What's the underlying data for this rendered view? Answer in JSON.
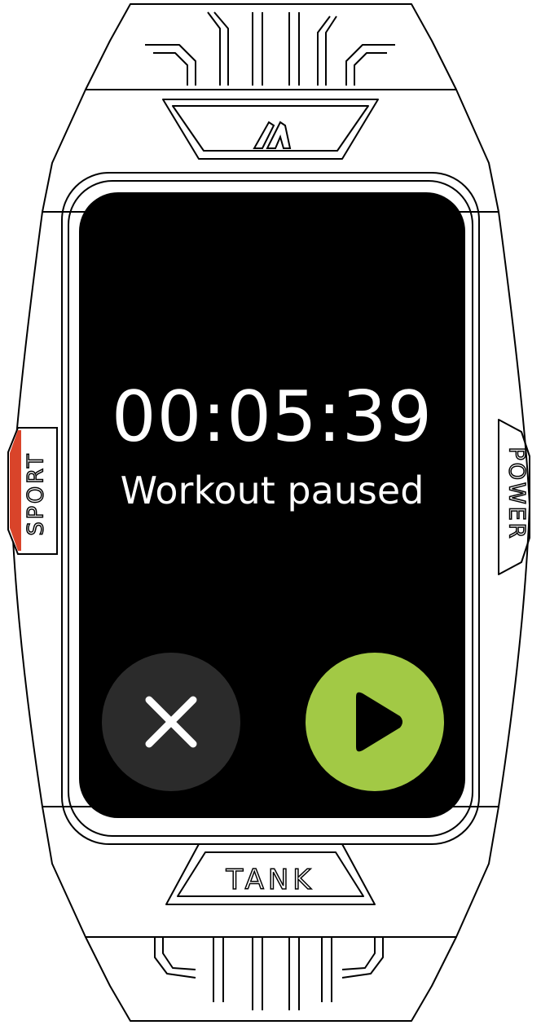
{
  "device": {
    "side_buttons": {
      "left_label": "SPORT",
      "right_label": "POWER"
    },
    "bottom_label": "TANK",
    "accent_color": "#d9442a"
  },
  "screen": {
    "elapsed_time": "00:05:39",
    "status_text": "Workout paused",
    "end_button": {
      "icon": "close-icon",
      "color": "#2b2b2b"
    },
    "resume_button": {
      "icon": "play-icon",
      "color": "#a2c945"
    }
  }
}
